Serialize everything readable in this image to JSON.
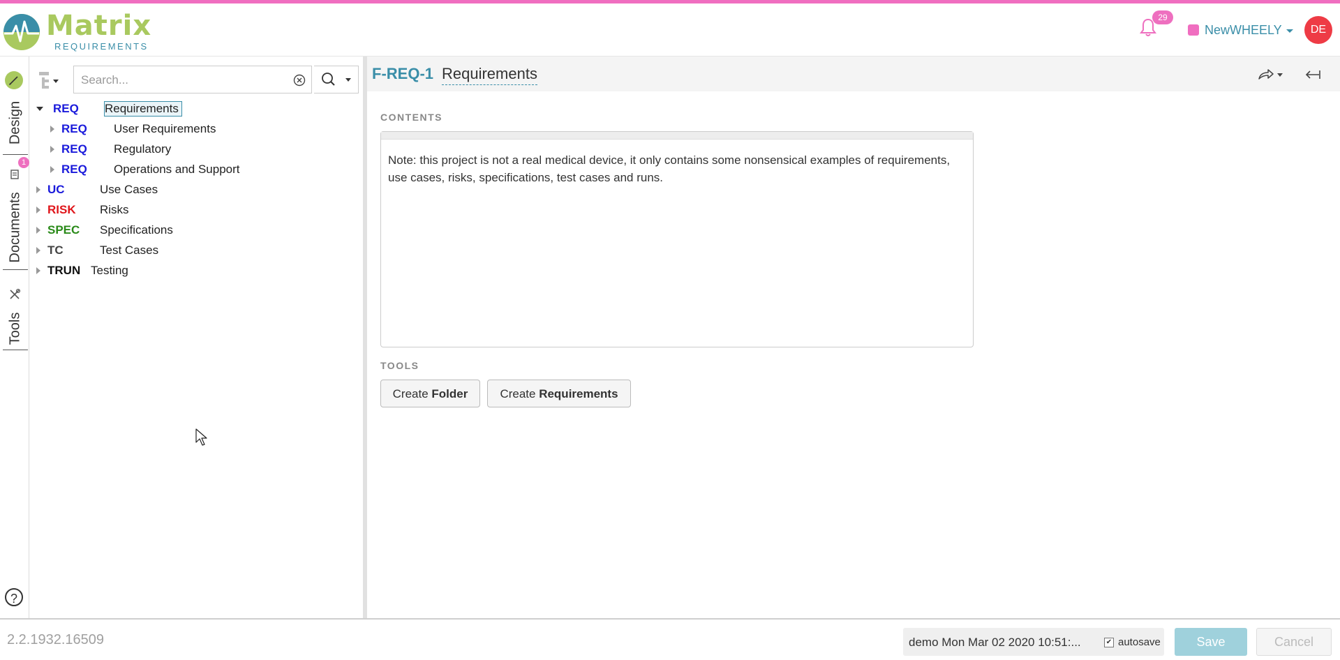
{
  "header": {
    "logo_word": "Matrix",
    "logo_sub": "REQUIREMENTS",
    "notifications_count": "29",
    "project_name": "NewWHEELY",
    "user_initials": "DE",
    "accent_color": "#f06ec0",
    "brand_blue": "#3a8ea8",
    "brand_green": "#a9c95f"
  },
  "rail": {
    "design_label": "Design",
    "documents_label": "Documents",
    "documents_badge": "1",
    "tools_label": "Tools",
    "help_label": "?"
  },
  "tree": {
    "search_placeholder": "Search...",
    "items": [
      {
        "cat": "REQ",
        "name": "Requirements",
        "color": "#1a1adb",
        "expanded": true,
        "selected": true
      },
      {
        "cat": "REQ",
        "name": "User Requirements",
        "color": "#1a1adb",
        "expanded": false
      },
      {
        "cat": "REQ",
        "name": "Regulatory",
        "color": "#1a1adb",
        "expanded": false
      },
      {
        "cat": "REQ",
        "name": "Operations and Support",
        "color": "#1a1adb",
        "expanded": false
      },
      {
        "cat": "UC",
        "name": "Use Cases",
        "color": "#1a1adb",
        "expanded": false
      },
      {
        "cat": "RISK",
        "name": "Risks",
        "color": "#e0161b",
        "expanded": false
      },
      {
        "cat": "SPEC",
        "name": "Specifications",
        "color": "#2a8a19",
        "expanded": false
      },
      {
        "cat": "TC",
        "name": "Test Cases",
        "color": "#444444",
        "expanded": false
      },
      {
        "cat": "TRUN",
        "name": "Testing",
        "color": "#111111",
        "expanded": false
      }
    ]
  },
  "main": {
    "item_id": "F-REQ-1",
    "item_title": "Requirements",
    "contents_label": "CONTENTS",
    "contents_text": "Note: this project is not a real medical device, it only contains some nonsensical examples of requirements, use cases, risks, specifications, test cases and runs.",
    "tools_label": "TOOLS",
    "create_folder_prefix": "Create ",
    "create_folder_bold": "Folder",
    "create_req_prefix": "Create ",
    "create_req_bold": "Requirements"
  },
  "footer": {
    "version": "2.2.1932.16509",
    "status_text": "demo Mon Mar 02 2020 10:51:...",
    "autosave_label": "autosave",
    "autosave_checked": true,
    "save_label": "Save",
    "cancel_label": "Cancel"
  }
}
